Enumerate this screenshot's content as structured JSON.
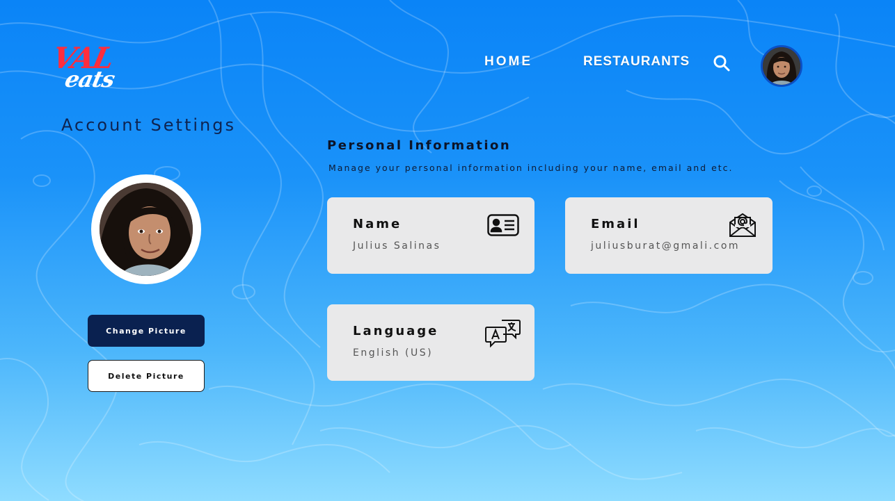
{
  "logo": {
    "line1": "VAL",
    "line2": "eats"
  },
  "nav": {
    "items": [
      {
        "label": "HOME"
      },
      {
        "label": "RESTAURANTS"
      }
    ],
    "search_icon": "search-icon",
    "avatar_icon": "user-avatar"
  },
  "sidebar": {
    "title": "Account Settings",
    "change_button": "Change Picture",
    "delete_button": "Delete Picture"
  },
  "personal_info": {
    "title": "Personal Information",
    "subtitle": "Manage your personal information including your name, email and etc.",
    "cards": [
      {
        "label": "Name",
        "value": "Julius Salinas",
        "icon": "id-card-icon"
      },
      {
        "label": "Email",
        "value": "juliusburat@gmali.com",
        "icon": "envelope-icon"
      },
      {
        "label": "Language",
        "value": "English (US)",
        "icon": "translate-icon"
      }
    ]
  },
  "colors": {
    "background_top": "#0a84f7",
    "background_bottom": "#8fdcff",
    "logo_red": "#ff2d3d",
    "navy": "#0a2150",
    "card_bg": "#e9e9ea"
  }
}
